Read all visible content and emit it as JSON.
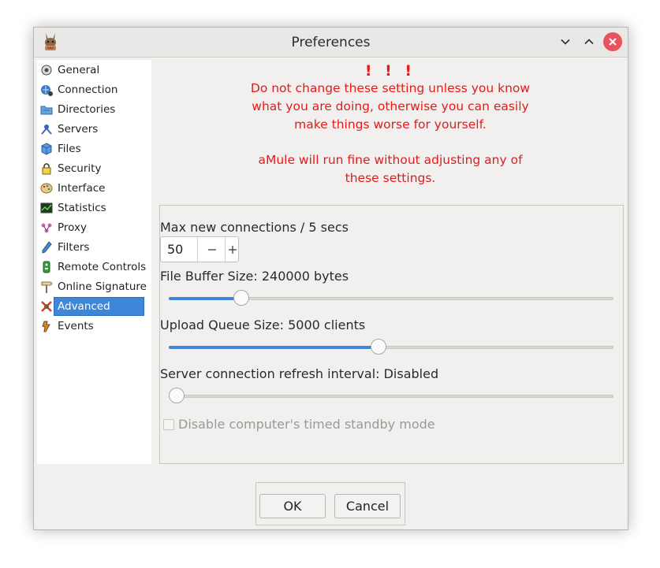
{
  "window": {
    "title": "Preferences"
  },
  "sidebar": {
    "selected_index": 12,
    "items": [
      {
        "label": "General",
        "icon": "general-icon"
      },
      {
        "label": "Connection",
        "icon": "connection-icon"
      },
      {
        "label": "Directories",
        "icon": "directories-icon"
      },
      {
        "label": "Servers",
        "icon": "servers-icon"
      },
      {
        "label": "Files",
        "icon": "files-icon"
      },
      {
        "label": "Security",
        "icon": "security-lock-icon"
      },
      {
        "label": "Interface",
        "icon": "interface-palette-icon"
      },
      {
        "label": "Statistics",
        "icon": "statistics-icon"
      },
      {
        "label": "Proxy",
        "icon": "proxy-icon"
      },
      {
        "label": "Filters",
        "icon": "filters-icon"
      },
      {
        "label": "Remote Controls",
        "icon": "remote-controls-icon"
      },
      {
        "label": "Online Signature",
        "icon": "online-signature-icon"
      },
      {
        "label": "Advanced",
        "icon": "advanced-icon"
      },
      {
        "label": "Events",
        "icon": "events-icon"
      }
    ]
  },
  "warning": {
    "marks": "! ! !",
    "line1": "Do not change these setting unless you know",
    "line2": "what you are doing, otherwise you can easily",
    "line3": "make things worse for yourself.",
    "line4": "aMule will run fine without adjusting any of",
    "line5": "these settings.",
    "color": "#e41a1a"
  },
  "settings": {
    "max_connections_label": "Max new connections / 5 secs",
    "max_connections_value": "50",
    "file_buffer_label": "File Buffer Size: 240000 bytes",
    "file_buffer_fraction": 0.15,
    "upload_queue_label": "Upload Queue Size: 5000 clients",
    "upload_queue_fraction": 0.47,
    "server_refresh_label": "Server connection refresh interval: Disabled",
    "server_refresh_fraction": 0.0,
    "standby_label": "Disable computer's timed standby mode",
    "standby_checked": false
  },
  "buttons": {
    "ok": "OK",
    "cancel": "Cancel"
  },
  "colors": {
    "accent": "#3d86d8",
    "close": "#e8535d"
  }
}
